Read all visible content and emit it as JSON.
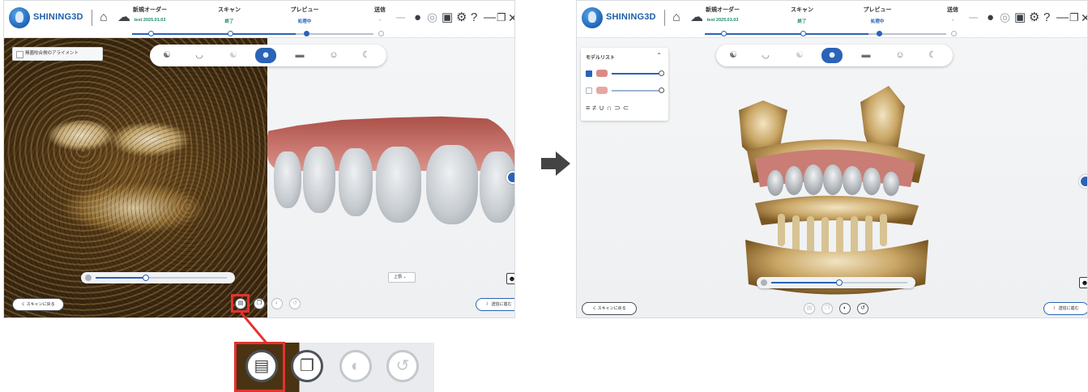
{
  "header": {
    "brand": "SHINING3D",
    "steps": [
      {
        "title": "新規オーダー",
        "sub": "test 2025.01.03"
      },
      {
        "title": "スキャン",
        "sub": "終了"
      },
      {
        "title": "プレビュー",
        "sub": "処理中"
      },
      {
        "title": "送信",
        "sub": "-"
      }
    ],
    "chip": "",
    "window_icons": [
      "user-icon",
      "target-icon",
      "snapshot-icon",
      "gear-icon",
      "help-icon",
      "minimize-icon",
      "restore-icon",
      "close-icon"
    ]
  },
  "left": {
    "align_checkbox_label": "無菌咬合側のアライメント",
    "back_button": "く スキャンに戻る",
    "jaw_dropdown": "上顎 ⌄",
    "slider_value": 0.38
  },
  "right": {
    "model_list_title": "モデルリスト",
    "models": [
      {
        "checked": true,
        "value": 1.0
      },
      {
        "checked": false,
        "value": 1.0
      }
    ],
    "back_button": "く スキャンに戻る",
    "next_button": "〉 送信に進む",
    "slider_value": 0.5
  },
  "left_next_button": "〉 送信に進む",
  "colors": {
    "accent": "#2a63b7",
    "highlight": "#e5322d",
    "status_green": "#1d8a6a"
  },
  "bottom_tools": [
    "overlay-a-icon",
    "overlay-copy-icon",
    "merge-icon",
    "reset-icon"
  ]
}
